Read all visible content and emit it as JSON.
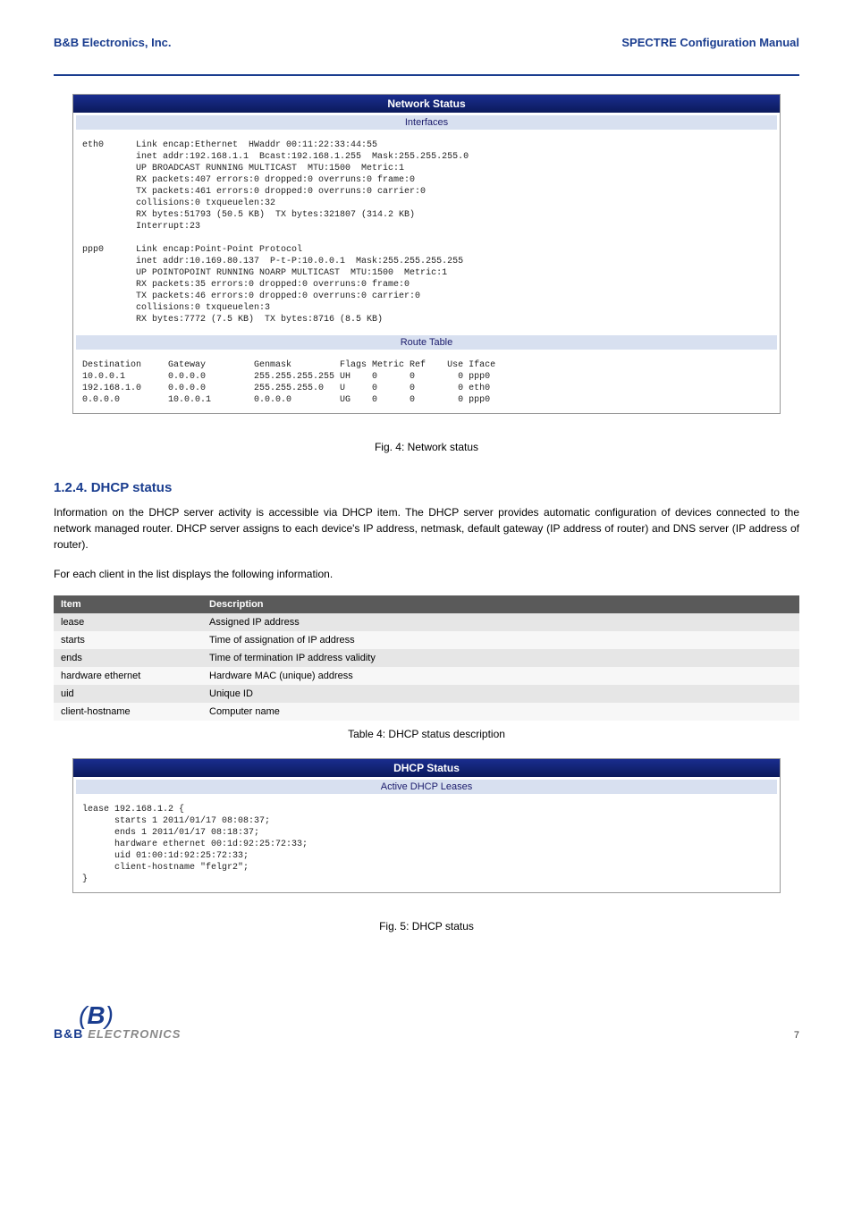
{
  "header": {
    "left": "B&B Electronics, Inc.",
    "right": "SPECTRE Configuration Manual"
  },
  "panel1": {
    "title": "Network Status",
    "sub1": "Interfaces",
    "ifaces": "eth0      Link encap:Ethernet  HWaddr 00:11:22:33:44:55\n          inet addr:192.168.1.1  Bcast:192.168.1.255  Mask:255.255.255.0\n          UP BROADCAST RUNNING MULTICAST  MTU:1500  Metric:1\n          RX packets:407 errors:0 dropped:0 overruns:0 frame:0\n          TX packets:461 errors:0 dropped:0 overruns:0 carrier:0\n          collisions:0 txqueuelen:32\n          RX bytes:51793 (50.5 KB)  TX bytes:321807 (314.2 KB)\n          Interrupt:23\n\nppp0      Link encap:Point-Point Protocol\n          inet addr:10.169.80.137  P-t-P:10.0.0.1  Mask:255.255.255.255\n          UP POINTOPOINT RUNNING NOARP MULTICAST  MTU:1500  Metric:1\n          RX packets:35 errors:0 dropped:0 overruns:0 frame:0\n          TX packets:46 errors:0 dropped:0 overruns:0 carrier:0\n          collisions:0 txqueuelen:3\n          RX bytes:7772 (7.5 KB)  TX bytes:8716 (8.5 KB)",
    "sub2": "Route Table",
    "route": "Destination     Gateway         Genmask         Flags Metric Ref    Use Iface\n10.0.0.1        0.0.0.0         255.255.255.255 UH    0      0        0 ppp0\n192.168.1.0     0.0.0.0         255.255.255.0   U     0      0        0 eth0\n0.0.0.0         10.0.0.1        0.0.0.0         UG    0      0        0 ppp0"
  },
  "caption1": "Fig. 4: Network status",
  "section": {
    "num": "1.2.4.",
    "title": "DHCP status"
  },
  "para1": "Information on the DHCP server activity is accessible via DHCP item. The DHCP server provides automatic configuration of devices connected to the network managed router. DHCP server assigns to each device's IP address, netmask, default gateway (IP address of router) and DNS server (IP address of router).",
  "para2": "For each client in the list displays the following information.",
  "table": {
    "h1": "Item",
    "h2": "Description",
    "rows": [
      [
        "lease",
        "Assigned IP address"
      ],
      [
        "starts",
        "Time of assignation of IP address"
      ],
      [
        "ends",
        "Time of termination IP address validity"
      ],
      [
        "hardware ethernet",
        "Hardware MAC (unique) address"
      ],
      [
        "uid",
        "Unique ID"
      ],
      [
        "client-hostname",
        "Computer name"
      ]
    ]
  },
  "caption2": "Table 4: DHCP status description",
  "panel2": {
    "title": "DHCP Status",
    "sub1": "Active DHCP Leases",
    "body": "lease 192.168.1.2 {\n      starts 1 2011/01/17 08:08:37;\n      ends 1 2011/01/17 08:18:37;\n      hardware ethernet 00:1d:92:25:72:33;\n      uid 01:00:1d:92:25:72:33;\n      client-hostname \"felgr2\";\n}"
  },
  "caption3": "Fig. 5: DHCP status",
  "pagenum": "7"
}
